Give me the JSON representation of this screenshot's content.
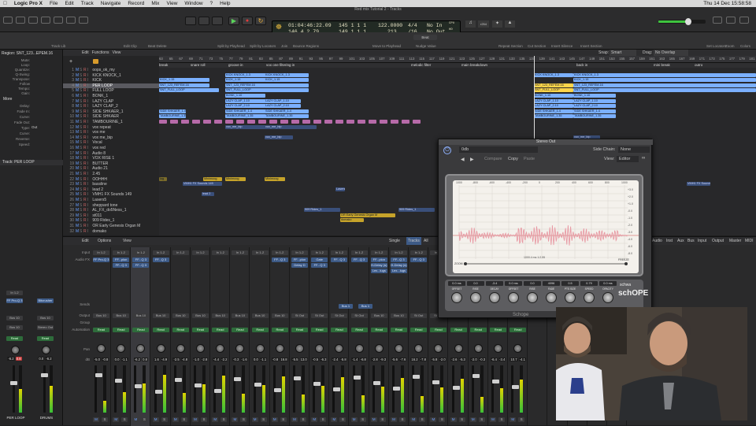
{
  "menubar": {
    "apple": "",
    "items": [
      "Logic Pro X",
      "File",
      "Edit",
      "Track",
      "Navigate",
      "Record",
      "Mix",
      "View",
      "Window",
      "?",
      "Help"
    ],
    "clock": "Thu 14 Dec  15:58:58"
  },
  "window_title": "Red mix Tutorial 2 - Tracks",
  "lcd": {
    "position_time": "01:04:46:22.09",
    "position_bars": "145  1  1  1",
    "tempo": "122.0000",
    "sig": "4/4",
    "in": "No In",
    "row2_time": "146  4  2  79",
    "row2_bars": "149  1  1  1",
    "row2_tempo": "213",
    "row2_div": "/16",
    "out": "No Out",
    "cpu_label": "CPU",
    "hd_label": "HD",
    "badge": "r254"
  },
  "toolbar2_labels": [
    "Track Lib",
    "Edit Clip",
    "Beat Delete",
    "Split by Playhead",
    "Split by Locators",
    "Join",
    "Bounce Regions",
    "Move to Playhead",
    "Nudge Value",
    "Repeat Section",
    "Cut Section",
    "Insert Silence",
    "Insert Section",
    "Set Locators",
    "Zoom",
    "Colors"
  ],
  "nudge_value": "Beat",
  "inspector": {
    "region_title": "Region: SNT_123...EPEM.16",
    "fields": [
      "Mute:",
      "Loop:",
      "Quantize:",
      "Q-Swing:",
      "Transpose:",
      "Follow Tempo:",
      "Gain:"
    ],
    "more": "More",
    "more_fields": [
      "Delay:",
      "Fade In:",
      "Curve:",
      "Fade Out:",
      "Type:",
      "Curve:",
      "Reverse:",
      "Speed:"
    ],
    "fade_type": "Out",
    "track_title": "Track: PER LOOP",
    "strip1": {
      "name": "PER LOOP",
      "plug": "FF Pro-Q 3",
      "send": "Bus 10",
      "group": "Bus 10",
      "auto": "Read",
      "db": "-6.2",
      "db2": "0.8",
      "io": "In 1-2"
    },
    "strip2": {
      "name": "DRUMS",
      "plug": "Bitcrusher",
      "send": "Bus 10",
      "group": "Stereo Out",
      "auto": "Read",
      "db": "0.0",
      "db2": "-6.2"
    }
  },
  "arrange_header": {
    "edit": "Edit",
    "functions": "Functions",
    "view": "View",
    "snap_label": "Snap:",
    "snap_value": "Smart",
    "drag_label": "Drag:",
    "drag_value": "No Overlap",
    "ruler": [
      "63",
      "65",
      "67",
      "69",
      "71",
      "73",
      "75",
      "77",
      "79",
      "81",
      "83",
      "85",
      "87",
      "89",
      "91",
      "93",
      "95",
      "97",
      "99",
      "101",
      "103",
      "105",
      "107",
      "109",
      "111",
      "113",
      "115",
      "117",
      "119",
      "121",
      "123",
      "125",
      "127",
      "129",
      "131",
      "133",
      "135",
      "137",
      "139",
      "141",
      "143",
      "145",
      "147",
      "149",
      "151",
      "153",
      "155",
      "157",
      "159",
      "161",
      "163",
      "165",
      "167",
      "169",
      "171",
      "173",
      "175",
      "177",
      "179",
      "181"
    ],
    "markers": [
      "break",
      "snare roll",
      "groove in",
      "vox one filtering in",
      "melodic filter",
      "main breakdown",
      "back in",
      "mini break",
      "outro"
    ]
  },
  "tracks": [
    {
      "n": "1",
      "name": "oops_ok_my"
    },
    {
      "n": "2",
      "name": "KICK KNOCK_1"
    },
    {
      "n": "3",
      "name": "KICK"
    },
    {
      "n": "4",
      "name": "PER LOOP",
      "selected": true
    },
    {
      "n": "5",
      "name": "FULL LOOP"
    },
    {
      "n": "6",
      "name": "BONK_1"
    },
    {
      "n": "7",
      "name": "LAZY CLAP"
    },
    {
      "n": "8",
      "name": "LAZY CLAP_2"
    },
    {
      "n": "9",
      "name": "SIDE SHKAER_1"
    },
    {
      "n": "10",
      "name": "SIDE SHKAER"
    },
    {
      "n": "11",
      "name": "TAMBOURINE_1"
    },
    {
      "n": "12",
      "name": "vox repeat"
    },
    {
      "n": "13",
      "name": "vox me"
    },
    {
      "n": "14",
      "name": "vox me_bip"
    },
    {
      "n": "15",
      "name": "Vocal"
    },
    {
      "n": "16",
      "name": "vox red"
    },
    {
      "n": "17",
      "name": "Audio 8"
    },
    {
      "n": "18",
      "name": "VOX RISE 1"
    },
    {
      "n": "19",
      "name": "BUTTER"
    },
    {
      "n": "20",
      "name": "Audio 21"
    },
    {
      "n": "21",
      "name": "2.45"
    },
    {
      "n": "22",
      "name": "OOHHH"
    },
    {
      "n": "23",
      "name": "bassline"
    },
    {
      "n": "24",
      "name": "lead 2"
    },
    {
      "n": "25",
      "name": "VMH1 FX Sounds 149"
    },
    {
      "n": "26",
      "name": "Lasers5"
    },
    {
      "n": "27",
      "name": "sheppard tone"
    },
    {
      "n": "28",
      "name": "AL_FX_do5Ness_1"
    },
    {
      "n": "29",
      "name": "st011"
    },
    {
      "n": "30",
      "name": "909 Rides_1"
    },
    {
      "n": "31",
      "name": "OR Early Genesis Organ M"
    },
    {
      "n": "32",
      "name": "domako"
    }
  ],
  "regions": {
    "kick_knock": "KICK KNOCK_1.3",
    "kick": "KICK_1.15",
    "per_loop": "SNT_123_REFEM.16",
    "full_loop": "SNT_FULL_LOOP",
    "bonk": "BONK_1.10",
    "lazy_clap": "LAZY CLAP_1.10",
    "lazy_clap2": "LAZY CLAP_2.10",
    "side": "SIDE SHKAER_1.4",
    "tamb": "TAMBOURINE_1.35",
    "vox_me": "vox_me_bip",
    "vox_red": "vox red",
    "lead": "Minimoog",
    "vmh": "VMH1 FX Sounds 149",
    "lasers": "Lasers",
    "lead2": "lead 2",
    "rides": "909 Rides_1",
    "organ": "OR Early Genesis Organ M",
    "domako": "domako",
    "log": "log"
  },
  "mixer_header": {
    "edit": "Edit",
    "options": "Options",
    "view": "View",
    "modes": [
      "Single",
      "Tracks",
      "All"
    ],
    "right_tabs": [
      "Audio",
      "Inst",
      "Aux",
      "Bus",
      "Input",
      "Output",
      "Master",
      "MIDI"
    ]
  },
  "mixer_row_labels": [
    "Input",
    "Audio FX",
    "Sends",
    "Output",
    "Group",
    "Automation",
    "Pan",
    "dB"
  ],
  "strips": [
    {
      "io": "In 1-2",
      "fx": [
        "FF Pro-Q 3",
        ""
      ],
      "out": "Bus 10",
      "auto": "Read",
      "db": "-5.0",
      "db2": "-0.8"
    },
    {
      "io": "In 1-2",
      "fx": [
        "FF...plon",
        "FF...Q 3"
      ],
      "out": "Bus 10",
      "auto": "Read",
      "db": "0.0",
      "db2": "-1.1"
    },
    {
      "io": "In 1-2",
      "fx": [
        "FF...Q 3",
        "FF...Q 3"
      ],
      "out": "Bus 10",
      "auto": "Read",
      "db": "-6.2",
      "db2": "0.8",
      "selected": true
    },
    {
      "io": "In 1-2",
      "fx": [
        "FF...Q 3",
        ""
      ],
      "out": "Bus 10",
      "auto": "Read",
      "db": "1.6",
      "db2": "-4.9"
    },
    {
      "io": "In 1-2",
      "fx": [
        "",
        ""
      ],
      "out": "Bus 10",
      "auto": "Read",
      "db": "-2.5",
      "db2": "-4.8"
    },
    {
      "io": "In 1-2",
      "fx": [
        "",
        ""
      ],
      "out": "Bus 10",
      "auto": "Read",
      "db": "-1.0",
      "db2": "-2.8"
    },
    {
      "io": "In 1-2",
      "fx": [
        "",
        ""
      ],
      "out": "Bus 10",
      "auto": "Read",
      "db": "-4.4",
      "db2": "-2.2"
    },
    {
      "io": "In 1-2",
      "fx": [
        "",
        ""
      ],
      "out": "Bus 10",
      "auto": "Read",
      "db": "-0.3",
      "db2": "-1.6"
    },
    {
      "io": "In 1-2",
      "fx": [
        "",
        ""
      ],
      "out": "Bus 10",
      "auto": "Read",
      "db": "0.0",
      "db2": "-1.1"
    },
    {
      "io": "In 1-2",
      "fx": [
        "FF...Q 3",
        ""
      ],
      "out": "Bus 10",
      "auto": "Read",
      "db": "-0.8",
      "db2": "16.8"
    },
    {
      "io": "In 1-2",
      "fx": [
        "FF...plon",
        "Delay D"
      ],
      "out": "St Out",
      "auto": "Read",
      "db": "-5.5",
      "db2": "13.0"
    },
    {
      "io": "In 1-2",
      "fx": [
        "Gate",
        "FF...Q 3"
      ],
      "out": "St Out",
      "auto": "Read",
      "db": "-0.5",
      "db2": "-6.3"
    },
    {
      "io": "In 1-2",
      "fx": [
        "FF...Q 3",
        ""
      ],
      "out": "St Out",
      "auto": "Read",
      "db": "-2.4",
      "db2": "-5.8"
    },
    {
      "io": "In 1-2",
      "fx": [
        "FF...Q 3",
        ""
      ],
      "out": "St Out",
      "auto": "Read",
      "db": "-1.4",
      "db2": "-6.8"
    },
    {
      "io": "In 1-2",
      "fx": [
        "FF...plon",
        "H-Delay (s)",
        "Lex...lugs"
      ],
      "out": "Bus 10",
      "auto": "Read",
      "db": "-2.8",
      "db2": "-9.3"
    },
    {
      "io": "In 1-2",
      "fx": [
        "FF...Q 3",
        "H-Delay (s)",
        "Lex...lugs"
      ],
      "out": "Bus 10",
      "auto": "Read",
      "db": "-5.6",
      "db2": "-7.6"
    },
    {
      "io": "In 1-2",
      "fx": [
        "FF...Q 3",
        ""
      ],
      "out": "St Out",
      "auto": "Read",
      "db": "16.2",
      "db2": "-7.8"
    },
    {
      "io": "In 1-2",
      "fx": [
        "",
        ""
      ],
      "out": "St Out",
      "auto": "Read",
      "db": "-5.8",
      "db2": "-2.0"
    },
    {
      "io": "In 1-2",
      "fx": [
        "",
        ""
      ],
      "out": "St Out",
      "auto": "Read",
      "db": "-2.6",
      "db2": "-5.3"
    },
    {
      "io": "In 1-2",
      "fx": [
        "",
        ""
      ],
      "out": "St Out",
      "auto": "Read",
      "db": "-2.0",
      "db2": "-0.3"
    },
    {
      "io": "In 1-2",
      "fx": [
        "",
        ""
      ],
      "out": "St Out",
      "auto": "Read",
      "db": "-6.4",
      "db2": "-3.4"
    },
    {
      "io": "In 1-2",
      "fx": [
        "",
        ""
      ],
      "out": "St Out",
      "auto": "Read",
      "db": "10.7",
      "db2": "-4.1"
    }
  ],
  "right_strips": [
    {
      "fx": [
        "sale",
        "FF...Q 3"
      ]
    },
    {
      "fx": [
        "EX04",
        ""
      ]
    },
    {
      "fx": [
        "H-Delay (s)",
        "CL...com",
        "Vocal Rev",
        "FF...Q 3"
      ]
    },
    {
      "fx": [
        "Bitcrusher",
        ""
      ]
    },
    {
      "fx": [
        "FF Pro-Q 3",
        "Bitcrusher",
        "UniMB (s)",
        "Magic AB",
        "FF Pro-L",
        "Schope",
        "Gain"
      ]
    }
  ],
  "sends_label": "Bus 1",
  "plugin": {
    "preset": "0db",
    "title": "Stereo Out",
    "side_chain_label": "Side Chain:",
    "side_chain_value": "None",
    "view_label": "View:",
    "view_value": "Editor",
    "compare": "Compare",
    "copy": "Copy",
    "paste": "Paste",
    "brand": "schwa",
    "product": "schOPE",
    "footer": "Schope",
    "scope_top_labels": [
      "1000",
      "-800",
      "-600",
      "-400",
      "-200",
      "0",
      "200",
      "400",
      "600",
      "800",
      "1000"
    ],
    "scope_right_labels": [
      "+3.0",
      "+2.0",
      "+1.0",
      "-0.0",
      "-1.0",
      "-2.0",
      "-3.0",
      "-4.0",
      "-6.0",
      "-8.0"
    ],
    "scope_info": "1000.4 ms  1:2.95",
    "zoom_label": "ZOOM",
    "freeze_label": "FREEZE",
    "readouts": [
      "0.0 ms",
      "0.0",
      "-3.4",
      "0.0 ms",
      "0.0",
      "4096",
      "0.5",
      "0.79",
      "0.0 ms"
    ],
    "knob_labels": [
      "OFFSET",
      "RISE",
      "DECAY",
      "OFFSET",
      "RISE",
      "FADE",
      "PTS SIZE",
      "SPEED",
      "OPACITY"
    ],
    "knob_sub": "0.0 dB   -3.4   0.0 ms   0.0   4096   0.5   0.79   0.0 ms"
  },
  "webcam": {
    "description_free": true
  }
}
